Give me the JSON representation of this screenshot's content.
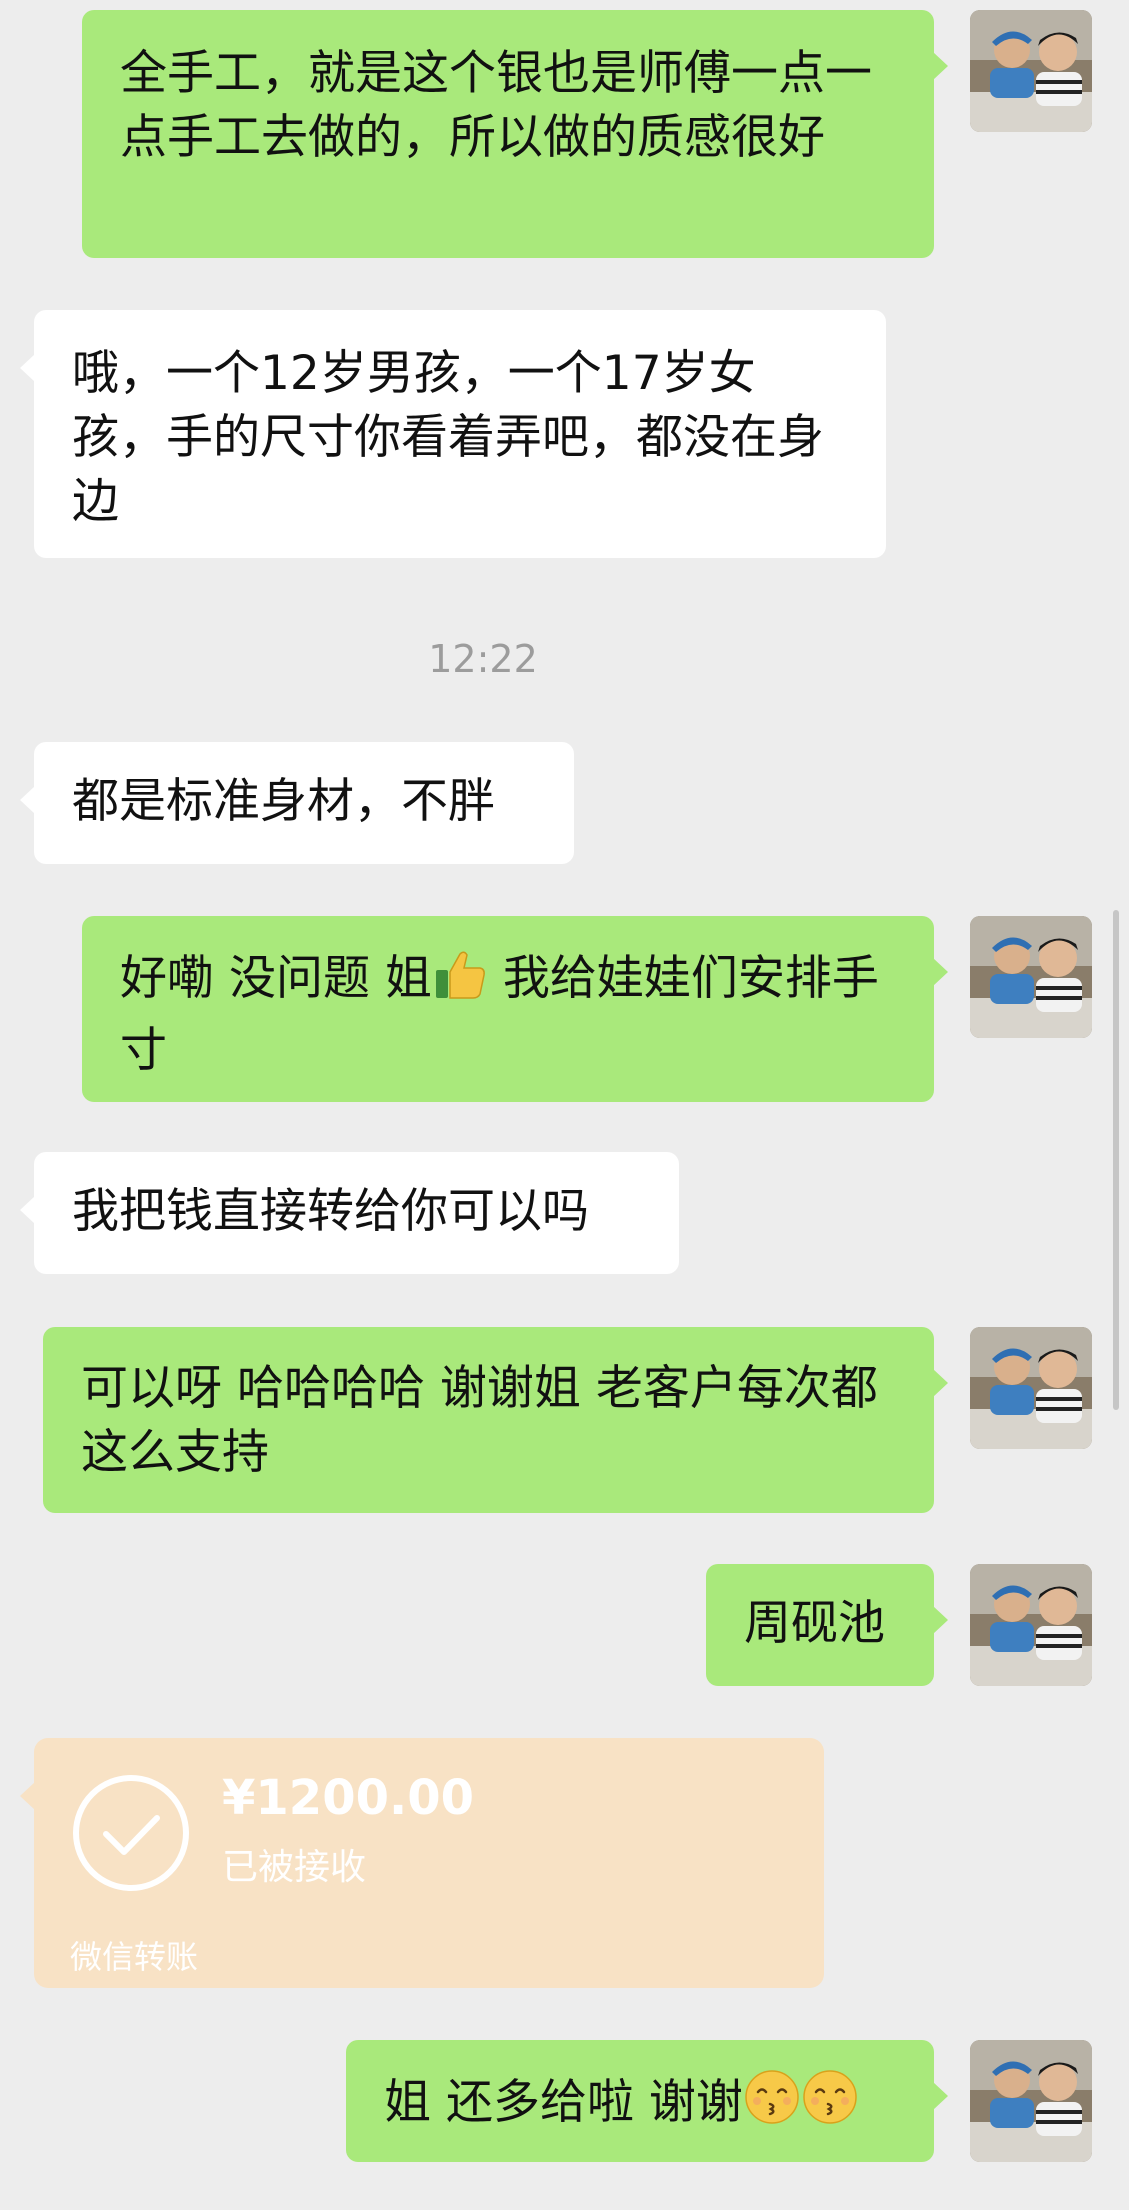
{
  "messages": {
    "m1": "全手工，就是这个银也是师傅一点一点手工去做的，所以做的质感很好",
    "m2": "哦，一个12岁男孩，一个17岁女孩，手的尺寸你看着弄吧，都没在身边",
    "timestamp": "12:22",
    "m3": "都是标准身材，不胖",
    "m4_a": "好嘞 没问题 姐",
    "m4_emoji": "thumbs-up",
    "m4_b": " 我给娃娃们安排手寸",
    "m5": "我把钱直接转给你可以吗",
    "m6": "可以呀 哈哈哈哈 谢谢姐 老客户每次都这么支持",
    "m7": "周砚池",
    "m8_text": "姐 还多给啦 谢谢",
    "m8_emoji": "kissing-face-with-smiling-eyes"
  },
  "transfer": {
    "amount": "¥1200.00",
    "status": "已被接收",
    "label": "微信转账",
    "icon": "check-circle-icon"
  },
  "colors": {
    "background": "#ededed",
    "my_bubble": "#a9e97b",
    "other_bubble": "#ffffff",
    "transfer_card": "#f8e2c5",
    "timestamp_text": "#9c9c9c"
  },
  "avatar": "avatar-photo-two-people"
}
